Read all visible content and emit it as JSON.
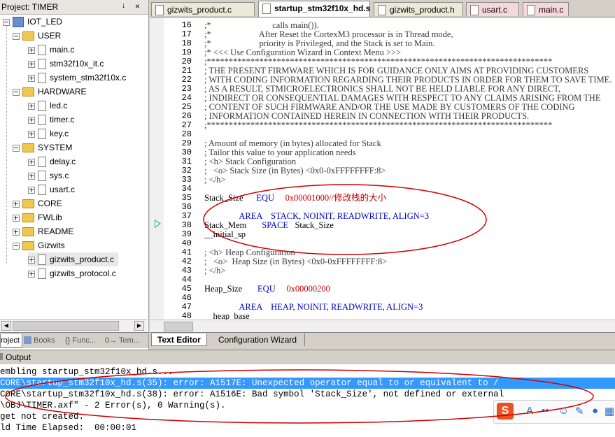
{
  "project": {
    "title": "Project: TIMER",
    "pin": "↓",
    "close": "×",
    "root": "IOT_LED",
    "groups": [
      {
        "name": "USER",
        "expanded": true,
        "files": [
          "main.c",
          "stm32f10x_it.c",
          "system_stm32f10x.c"
        ]
      },
      {
        "name": "HARDWARE",
        "expanded": true,
        "files": [
          "led.c",
          "timer.c",
          "key.c"
        ]
      },
      {
        "name": "SYSTEM",
        "expanded": true,
        "files": [
          "delay.c",
          "sys.c",
          "usart.c"
        ]
      },
      {
        "name": "CORE",
        "expanded": false,
        "files": []
      },
      {
        "name": "FWLib",
        "expanded": false,
        "files": []
      },
      {
        "name": "README",
        "expanded": false,
        "files": []
      },
      {
        "name": "Gizwits",
        "expanded": true,
        "files": [
          "gizwits_product.c",
          "gizwits_protocol.c"
        ]
      }
    ],
    "selected_file": "gizwits_product.c",
    "tabs": [
      "roject",
      "Books",
      "{} Func...",
      "0→ Tem..."
    ]
  },
  "editor": {
    "tabs": [
      {
        "label": "gizwits_product.c",
        "active": false,
        "pink": false
      },
      {
        "label": "startup_stm32f10x_hd.s",
        "active": true,
        "pink": false
      },
      {
        "label": "gizwits_product.h",
        "active": false,
        "pink": false
      },
      {
        "label": "usart.c",
        "active": false,
        "pink": true
      },
      {
        "label": "main.c",
        "active": false,
        "pink": true
      }
    ],
    "lines": [
      {
        "n": "16",
        "segs": [
          {
            "t": ";*                            calls main()).",
            "c": "cm"
          }
        ]
      },
      {
        "n": "17",
        "segs": [
          {
            "t": ";*                      After Reset the CortexM3 processor is in Thread mode,",
            "c": "cm"
          }
        ]
      },
      {
        "n": "18",
        "segs": [
          {
            "t": ";*                      priority is Privileged, and the Stack is set to Main.",
            "c": "cm"
          }
        ]
      },
      {
        "n": "19",
        "segs": [
          {
            "t": ";* <<< Use Configuration Wizard in Context Menu >>>",
            "c": "cm"
          }
        ]
      },
      {
        "n": "20",
        "segs": [
          {
            "t": ";*******************************************************************************",
            "c": "cm"
          }
        ]
      },
      {
        "n": "21",
        "segs": [
          {
            "t": "; THE PRESENT FIRMWARE WHICH IS FOR GUIDANCE ONLY AIMS AT PROVIDING CUSTOMERS",
            "c": "cm"
          }
        ]
      },
      {
        "n": "22",
        "segs": [
          {
            "t": "; WITH CODING INFORMATION REGARDING THEIR PRODUCTS IN ORDER FOR THEM TO SAVE TIME.",
            "c": "cm"
          }
        ]
      },
      {
        "n": "23",
        "segs": [
          {
            "t": "; AS A RESULT, STMICROELECTRONICS SHALL NOT BE HELD LIABLE FOR ANY DIRECT,",
            "c": "cm"
          }
        ]
      },
      {
        "n": "24",
        "segs": [
          {
            "t": "; INDIRECT OR CONSEQUENTIAL DAMAGES WITH RESPECT TO ANY CLAIMS ARISING FROM THE",
            "c": "cm"
          }
        ]
      },
      {
        "n": "25",
        "segs": [
          {
            "t": "; CONTENT OF SUCH FIRMWARE AND/OR THE USE MADE BY CUSTOMERS OF THE CODING",
            "c": "cm"
          }
        ]
      },
      {
        "n": "26",
        "segs": [
          {
            "t": "; INFORMATION CONTAINED HEREIN IN CONNECTION WITH THEIR PRODUCTS.",
            "c": "cm"
          }
        ]
      },
      {
        "n": "27",
        "segs": [
          {
            "t": ";*******************************************************************************",
            "c": "cm"
          }
        ]
      },
      {
        "n": "28",
        "segs": [
          {
            "t": "",
            "c": ""
          }
        ]
      },
      {
        "n": "29",
        "segs": [
          {
            "t": "; Amount of memory (in bytes) allocated for Stack",
            "c": "cm"
          }
        ]
      },
      {
        "n": "30",
        "segs": [
          {
            "t": "; Tailor this value to your application needs",
            "c": "cm"
          }
        ]
      },
      {
        "n": "31",
        "segs": [
          {
            "t": "; <h> Stack Configuration",
            "c": "cm"
          }
        ]
      },
      {
        "n": "32",
        "segs": [
          {
            "t": ";   <o> Stack Size (in Bytes) <0x0-0xFFFFFFFF:8>",
            "c": "cm"
          }
        ]
      },
      {
        "n": "33",
        "segs": [
          {
            "t": "; </h>",
            "c": "cm"
          }
        ]
      },
      {
        "n": "34",
        "segs": [
          {
            "t": "",
            "c": ""
          }
        ]
      },
      {
        "n": "35",
        "segs": [
          {
            "t": "Stack_Size      ",
            "c": ""
          },
          {
            "t": "EQU",
            "c": "kw"
          },
          {
            "t": "     ",
            "c": ""
          },
          {
            "t": "0x00001000//修改栈的大小",
            "c": "num"
          }
        ]
      },
      {
        "n": "36",
        "segs": [
          {
            "t": "",
            "c": ""
          }
        ]
      },
      {
        "n": "37",
        "segs": [
          {
            "t": "                ",
            "c": ""
          },
          {
            "t": "AREA    STACK, NOINIT, READWRITE, ALIGN=3",
            "c": "kw"
          }
        ]
      },
      {
        "n": "38",
        "segs": [
          {
            "t": "Stack_Mem       ",
            "c": ""
          },
          {
            "t": "SPACE",
            "c": "kw"
          },
          {
            "t": "   Stack_Size",
            "c": ""
          }
        ]
      },
      {
        "n": "39",
        "segs": [
          {
            "t": "__initial_sp",
            "c": ""
          }
        ]
      },
      {
        "n": "40",
        "segs": [
          {
            "t": "",
            "c": ""
          }
        ]
      },
      {
        "n": "41",
        "segs": [
          {
            "t": "; <h> Heap Configuration",
            "c": "cm"
          }
        ]
      },
      {
        "n": "42",
        "segs": [
          {
            "t": ";   <o>  Heap Size (in Bytes) <0x0-0xFFFFFFFF:8>",
            "c": "cm"
          }
        ]
      },
      {
        "n": "43",
        "segs": [
          {
            "t": "; </h>",
            "c": "cm"
          }
        ]
      },
      {
        "n": "44",
        "segs": [
          {
            "t": "",
            "c": ""
          }
        ]
      },
      {
        "n": "45",
        "segs": [
          {
            "t": "Heap_Size       ",
            "c": ""
          },
          {
            "t": "EQU",
            "c": "kw"
          },
          {
            "t": "     ",
            "c": ""
          },
          {
            "t": "0x00000200",
            "c": "num"
          }
        ]
      },
      {
        "n": "46",
        "segs": [
          {
            "t": "",
            "c": ""
          }
        ]
      },
      {
        "n": "47",
        "segs": [
          {
            "t": "                ",
            "c": ""
          },
          {
            "t": "AREA    HEAP, NOINIT, READWRITE, ALIGN=3",
            "c": "kw"
          }
        ]
      },
      {
        "n": "48",
        "segs": [
          {
            "t": "__heap_base",
            "c": ""
          }
        ]
      }
    ],
    "bottom_tabs": [
      "Text Editor",
      "Configuration Wizard"
    ]
  },
  "output": {
    "title": "Output",
    "lines": [
      {
        "text": "embling startup_stm32f10x_hd.s...",
        "highlight": false
      },
      {
        "text": "CORE\\startup_stm32f10x_hd.s(35): error: A1517E: Unexpected operator equal to or equivalent to /",
        "highlight": true
      },
      {
        "text": "CORE\\startup_stm32f10x_hd.s(38): error: A1516E: Bad symbol 'Stack_Size', not defined or external",
        "highlight": false
      },
      {
        "text": "\\OBJ\\TIMER.axf\" - 2 Error(s), 0 Warning(s).",
        "highlight": false
      },
      {
        "text": "get not created.",
        "highlight": false
      },
      {
        "text": "ld Time Elapsed:  00:00:01",
        "highlight": false
      }
    ]
  },
  "ime": {
    "logo": "S",
    "items": [
      "A",
      "••",
      "☺",
      "✎",
      "●",
      "▦"
    ]
  },
  "colors": {
    "selection": "#3399ff",
    "keyword": "#0000c8",
    "number": "#c00000",
    "annotation": "#cc0000"
  }
}
